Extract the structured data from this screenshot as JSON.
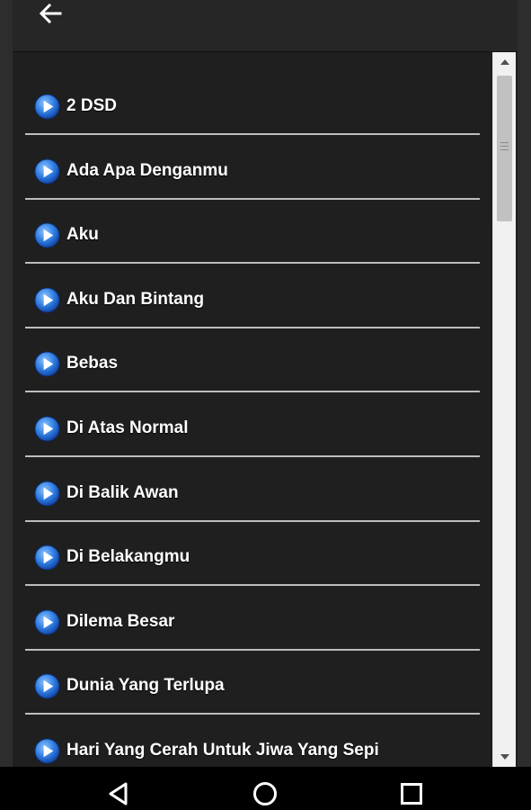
{
  "appbar": {
    "back_icon": "arrow-left-icon"
  },
  "songs": [
    {
      "title": "2 DSD"
    },
    {
      "title": "Ada Apa Denganmu"
    },
    {
      "title": "Aku"
    },
    {
      "title": "Aku Dan Bintang"
    },
    {
      "title": "Bebas"
    },
    {
      "title": "Di Atas Normal"
    },
    {
      "title": "Di Balik Awan"
    },
    {
      "title": "Di Belakangmu"
    },
    {
      "title": "Dilema Besar"
    },
    {
      "title": "Dunia Yang Terlupa"
    },
    {
      "title": "Hari Yang Cerah Untuk Jiwa Yang Sepi"
    }
  ],
  "item_icon": "play-circle-icon",
  "colors": {
    "background": "#1f1f1f",
    "appbar": "#262626",
    "divider": "#bdbdbd",
    "play_icon_blue": "#2f7de1",
    "text": "#ffffff"
  },
  "navbar": {
    "back_icon": "triangle-back-icon",
    "home_icon": "circle-home-icon",
    "recents_icon": "square-recents-icon"
  }
}
